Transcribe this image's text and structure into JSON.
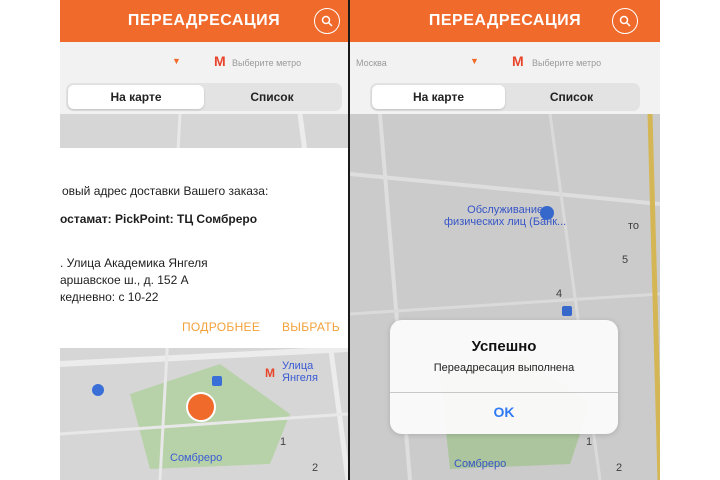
{
  "colors": {
    "accent": "#f06a2b",
    "link_orange": "#f2a13a",
    "ios_blue": "#2f7bf5"
  },
  "left_screen": {
    "header": {
      "title": "ПЕРЕАДРЕСАЦИЯ",
      "search_icon": "search-icon"
    },
    "filter": {
      "metro_placeholder": "Выберите метро",
      "dropdown_icon": "chevron-down-icon",
      "metro_icon": "metro-m-icon"
    },
    "segmented": {
      "map": "На карте",
      "list": "Список"
    },
    "info_card": {
      "line1": "овый адрес доставки Вашего заказа:",
      "line2": "остамат: PickPoint: ТЦ Сомбреро",
      "line3": ". Улица Академика Янгеля",
      "line4": "аршавское ш., д. 152 А",
      "line5": "кедневно: с 10-22",
      "more_button": "ПОДРОБНЕЕ",
      "select_button": "ВЫБРАТЬ"
    },
    "map": {
      "station_label_1": "Улица",
      "station_label_2": "Янгеля",
      "place_label": "Сомбреро",
      "num_1": "1",
      "num_2": "2"
    }
  },
  "right_screen": {
    "header": {
      "title": "ПЕРЕАДРЕСАЦИЯ",
      "search_icon": "search-icon"
    },
    "filter": {
      "city": "Москва",
      "metro_placeholder": "Выберите метро",
      "dropdown_icon": "chevron-down-icon",
      "metro_icon": "metro-m-icon"
    },
    "segmented": {
      "map": "На карте",
      "list": "Список"
    },
    "map": {
      "poi_line1": "Обслуживание",
      "poi_line2": "физических лиц (Банк...",
      "num_5": "5",
      "num_4": "4",
      "num_1": "1",
      "num_2": "2",
      "place_label": "Сомбреро",
      "edge_label": "то"
    },
    "dialog": {
      "title": "Успешно",
      "message": "Переадресация выполнена",
      "ok": "OK"
    }
  }
}
